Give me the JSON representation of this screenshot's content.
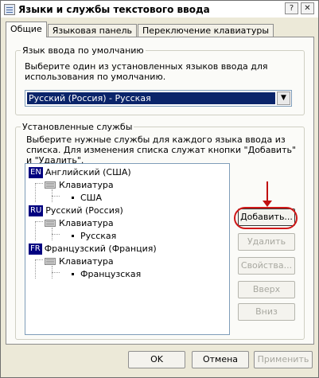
{
  "window": {
    "title": "Языки и службы текстового ввода",
    "title_icon": "keyboard-settings-icon",
    "help_button": "?",
    "close_button": "✕"
  },
  "tabs": [
    {
      "label": "Общие",
      "active": true
    },
    {
      "label": "Языковая панель",
      "active": false
    },
    {
      "label": "Переключение клавиатуры",
      "active": false
    }
  ],
  "default_language": {
    "legend": "Язык ввода по умолчанию",
    "hint": "Выберите один из установленных языков ввода для использования по умолчанию.",
    "selected": "Русский (Россия) - Русская",
    "arrow": "▼"
  },
  "installed_services": {
    "legend": "Установленные службы",
    "hint": "Выберите нужные службы для каждого языка ввода из списка. Для изменения списка служат кнопки \"Добавить\" и \"Удалить\".",
    "tree": [
      {
        "code": "EN",
        "language": "Английский (США)",
        "category": "Клавиатура",
        "layout": "США"
      },
      {
        "code": "RU",
        "language": "Русский (Россия)",
        "category": "Клавиатура",
        "layout": "Русская"
      },
      {
        "code": "FR",
        "language": "Французский (Франция)",
        "category": "Клавиатура",
        "layout": "Французская"
      }
    ],
    "buttons": {
      "add": "Добавить...",
      "remove": "Удалить",
      "properties": "Свойства...",
      "up": "Вверх",
      "down": "Вниз"
    }
  },
  "dialog_buttons": {
    "ok": "OK",
    "cancel": "Отмена",
    "apply": "Применить"
  },
  "annotation": {
    "color": "#d01818"
  }
}
